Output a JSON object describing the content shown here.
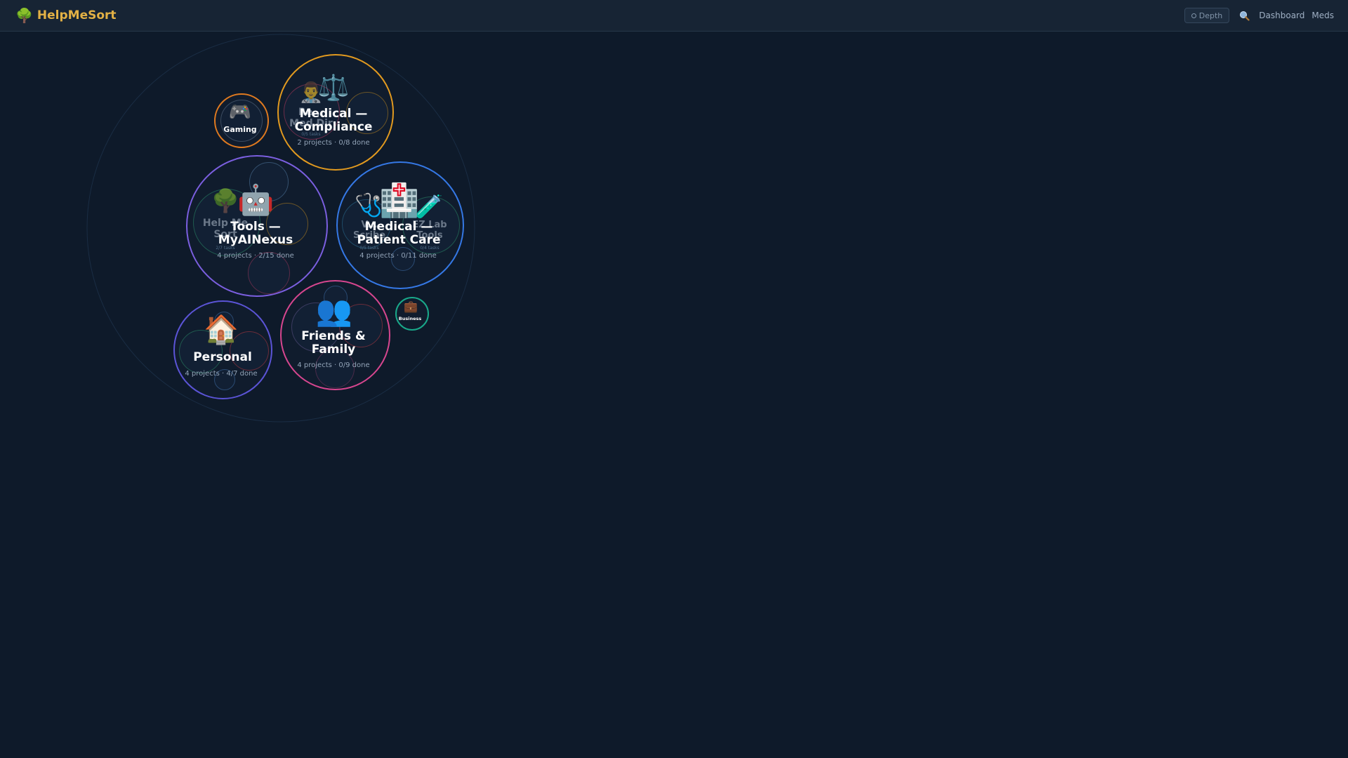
{
  "app": {
    "title": "HelpMeSort",
    "logo_icon": "tree-icon",
    "accent": "#e3b145"
  },
  "nav": {
    "depth_label": "Depth",
    "search_icon": "search-icon",
    "links": [
      "Dashboard",
      "Meds"
    ]
  },
  "bubbles": {
    "compliance": {
      "icon": "scales-icon",
      "title": "Medical — Compliance",
      "stats": "2 projects · 0/8 done",
      "color": "#e29a1f",
      "child": {
        "icon": "doctor-icon",
        "title": "Re... Med Dir",
        "stats": "0/5 tasks"
      }
    },
    "gaming": {
      "icon": "game-controller-icon",
      "title": "Gaming",
      "color": "#e07a1f"
    },
    "tools": {
      "icon": "robot-icon",
      "title": "Tools — MyAINexus",
      "stats": "4 projects · 2/15 done",
      "color": "#7b5fe0",
      "child": {
        "icon": "tree-icon",
        "title": "Help Me Sort",
        "stats": "2/7 tasks"
      }
    },
    "patient": {
      "icon": "hospital-icon",
      "title": "Medical — Patient Care",
      "stats": "4 projects · 0/11 done",
      "color": "#3578e5",
      "child_left": {
        "icon": "stethoscope-icon",
        "title": "V... Scribe",
        "stats": "0/5 tasks"
      },
      "child_right": {
        "icon": "test-tube-icon",
        "title": "EZ Lab Tools",
        "stats": "0/4 tasks"
      }
    },
    "friends": {
      "icon": "people-icon",
      "title": "Friends & Family",
      "stats": "4 projects · 0/9 done",
      "color": "#d7468f"
    },
    "personal": {
      "icon": "house-icon",
      "title": "Personal",
      "stats": "4 projects · 4/7 done",
      "color": "#5b54d6"
    },
    "business": {
      "icon": "briefcase-icon",
      "title": "Business",
      "color": "#19a88a"
    }
  }
}
